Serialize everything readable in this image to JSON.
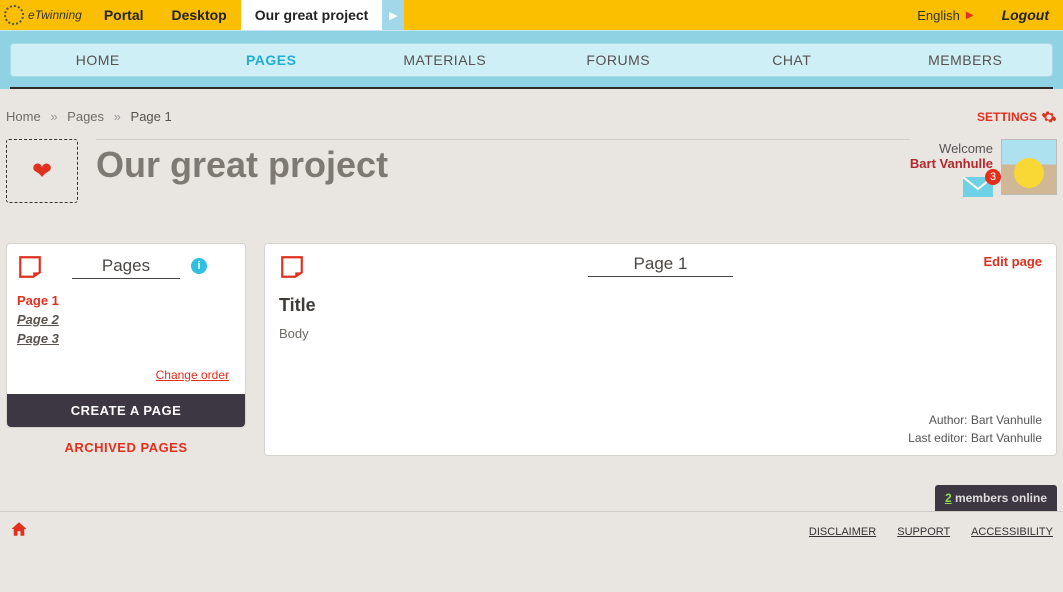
{
  "top": {
    "brand": "eTwinning",
    "portal": "Portal",
    "desktop": "Desktop",
    "project": "Our great project",
    "language": "English",
    "logout": "Logout"
  },
  "nav": {
    "home": "HOME",
    "pages": "PAGES",
    "materials": "MATERIALS",
    "forums": "FORUMS",
    "chat": "CHAT",
    "members": "MEMBERS"
  },
  "crumbs": {
    "home": "Home",
    "pages": "Pages",
    "current": "Page 1"
  },
  "settings_label": "SETTINGS",
  "project_title": "Our great project",
  "user": {
    "welcome": "Welcome",
    "name": "Bart Vanhulle",
    "mail_count": "3"
  },
  "sidebar": {
    "heading": "Pages",
    "items": {
      "p1": "Page 1",
      "p2": "Page 2",
      "p3": "Page 3"
    },
    "change_order": "Change order",
    "create": "CREATE A PAGE",
    "archived": "ARCHIVED PAGES"
  },
  "content": {
    "heading": "Page 1",
    "edit": "Edit page",
    "title": "Title",
    "body": "Body",
    "author_label": "Author: Bart Vanhulle",
    "editor_label": "Last editor: Bart Vanhulle"
  },
  "footer": {
    "online_count": "2",
    "online_label": " members online",
    "disclaimer": "DISCLAIMER",
    "support": "SUPPORT",
    "accessibility": "ACCESSIBILITY"
  }
}
